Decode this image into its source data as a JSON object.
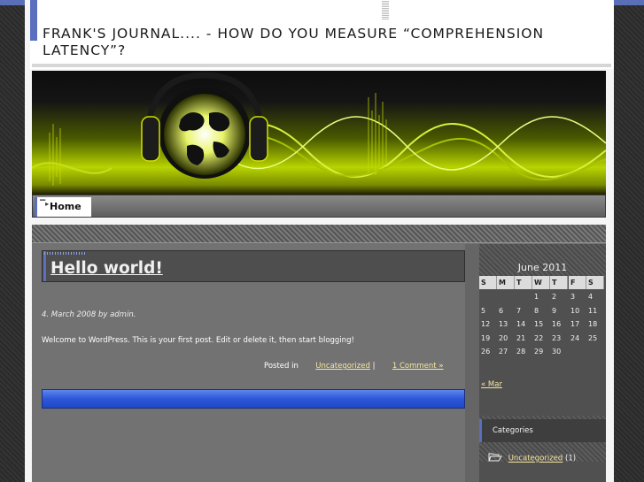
{
  "site": {
    "title": "FRANK'S JOURNAL.... - HOW DO YOU MEASURE “COMPREHENSION LATENCY”?"
  },
  "nav": {
    "items": [
      {
        "label": "Home"
      }
    ]
  },
  "post": {
    "title": "Hello world!",
    "date_line": "4. March 2008 by admin.",
    "body": "Welcome to WordPress. This is your first post. Edit or delete it, then start blogging!",
    "posted_in_label": "Posted in",
    "category_link": "Uncategorized",
    "separator": "|",
    "comments_link": "1 Comment »"
  },
  "calendar": {
    "caption": "June 2011",
    "weekday_headers": [
      "S",
      "M",
      "T",
      "W",
      "T",
      "F",
      "S"
    ],
    "weeks": [
      [
        "",
        "",
        "",
        "1",
        "2",
        "3",
        "4"
      ],
      [
        "5",
        "6",
        "7",
        "8",
        "9",
        "10",
        "11"
      ],
      [
        "12",
        "13",
        "14",
        "15",
        "16",
        "17",
        "18"
      ],
      [
        "19",
        "20",
        "21",
        "22",
        "23",
        "24",
        "25"
      ],
      [
        "26",
        "27",
        "28",
        "29",
        "30",
        "",
        ""
      ]
    ],
    "prev_link": "« Mar"
  },
  "categories": {
    "title": "Categories",
    "items": [
      {
        "label": "Uncategorized",
        "count": "(1)"
      }
    ]
  },
  "colors": {
    "accent_blue": "#5a6fc0",
    "link_yellow": "#f5e6a0",
    "header_green": "#b8d400",
    "bar_blue": "#2c57d8"
  },
  "icons": {
    "home": "small-tab-icon",
    "category": "open-folder-icon"
  }
}
